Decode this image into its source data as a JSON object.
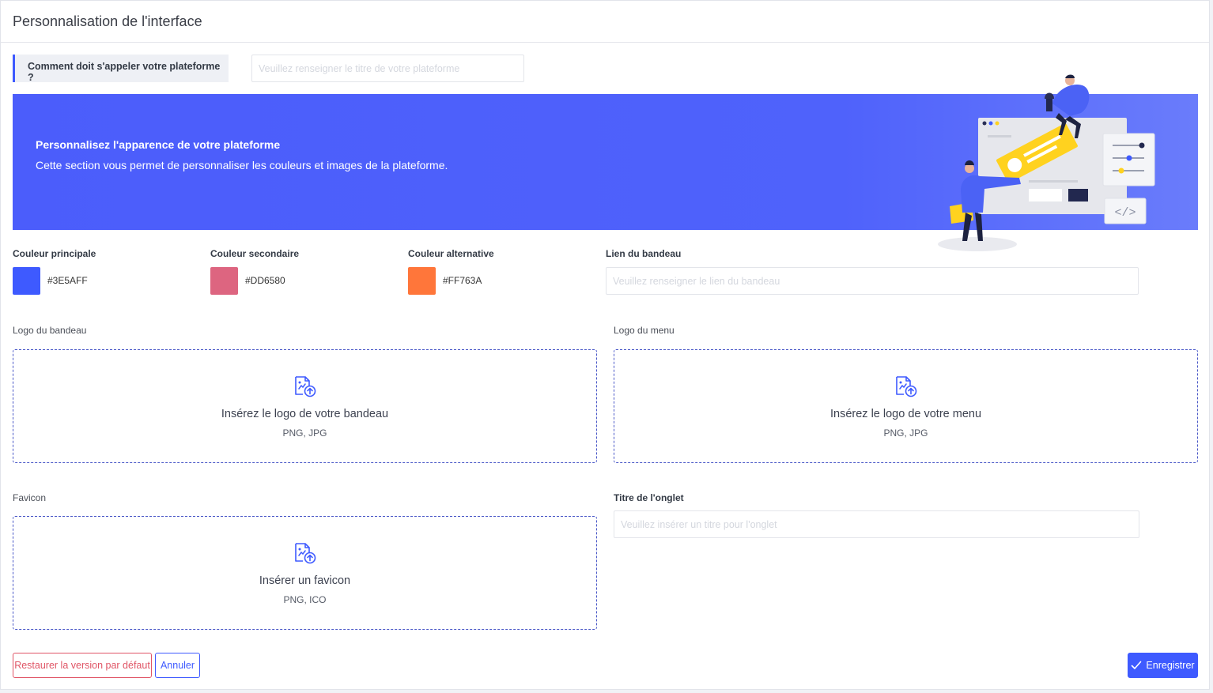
{
  "header": {
    "title": "Personnalisation de l'interface"
  },
  "platform_name": {
    "label": "Comment doit s'appeler votre plateforme ?",
    "value": "",
    "placeholder": "Veuillez renseigner le titre de votre plateforme"
  },
  "banner": {
    "title": "Personnalisez l'apparence de votre plateforme",
    "description": "Cette section vous permet de personnaliser les couleurs et images de la plateforme."
  },
  "colors": {
    "primary": {
      "label": "Couleur principale",
      "hex": "#3E5AFF",
      "value": "#3E5AFF"
    },
    "secondary": {
      "label": "Couleur secondaire",
      "hex": "#DD6580",
      "value": "#DD6580"
    },
    "alternative": {
      "label": "Couleur alternative",
      "hex": "#FF763A",
      "value": "#FF763A"
    }
  },
  "banner_link": {
    "label": "Lien du bandeau",
    "value": "",
    "placeholder": "Veuillez renseigner le lien du bandeau"
  },
  "uploads": {
    "banner_logo": {
      "label": "Logo du bandeau",
      "title": "Insérez le logo de votre bandeau",
      "formats": "PNG, JPG",
      "icon": "image-upload-icon"
    },
    "menu_logo": {
      "label": "Logo du menu",
      "title": "Insérez le logo de votre menu",
      "formats": "PNG, JPG",
      "icon": "image-upload-icon"
    },
    "favicon": {
      "label": "Favicon",
      "title": "Insérer un favicon",
      "formats": "PNG, ICO",
      "icon": "image-upload-icon"
    }
  },
  "tab_title": {
    "label": "Titre de l'onglet",
    "value": "",
    "placeholder": "Veuillez insérer un titre pour l'onglet"
  },
  "actions": {
    "restore_label": "Restaurer la version par défaut",
    "cancel_label": "Annuler",
    "save_label": "Enregistrer",
    "save_icon": "check-icon"
  },
  "theme": {
    "accent": "#3E5AFF",
    "danger": "#E05566",
    "banner_bg": "#4F62FB"
  }
}
